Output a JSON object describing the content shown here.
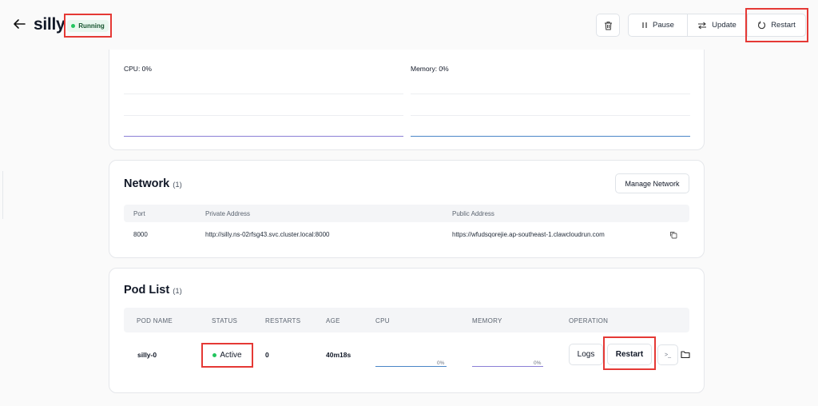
{
  "header": {
    "title": "silly",
    "status": "Running",
    "buttons": {
      "pause": "Pause",
      "update": "Update",
      "restart": "Restart"
    }
  },
  "monitor": {
    "cpu_label": "CPU: 0%",
    "memory_label": "Memory: 0%",
    "colors": {
      "cpu_line": "#8b7fd6",
      "memory_line": "#4a86c7"
    }
  },
  "network": {
    "title": "Network",
    "count": "(1)",
    "manage_label": "Manage Network",
    "columns": [
      "Port",
      "Private Address",
      "Public Address"
    ],
    "rows": [
      {
        "port": "8000",
        "private": "http://silly.ns-02rfsg43.svc.cluster.local:8000",
        "public": "https://wfudsqorejie.ap-southeast-1.clawcloudrun.com"
      }
    ]
  },
  "pods": {
    "title": "Pod List",
    "count": "(1)",
    "columns": [
      "POD NAME",
      "STATUS",
      "RESTARTS",
      "AGE",
      "CPU",
      "MEMORY",
      "OPERATION"
    ],
    "rows": [
      {
        "name": "silly-0",
        "status": "Active",
        "restarts": "0",
        "age": "40m18s",
        "cpu": "0%",
        "memory": "0%"
      }
    ],
    "actions": {
      "logs": "Logs",
      "restart": "Restart",
      "terminal": ">_"
    }
  },
  "colors": {
    "accent_red": "#e53935",
    "status_green": "#22c55e"
  }
}
